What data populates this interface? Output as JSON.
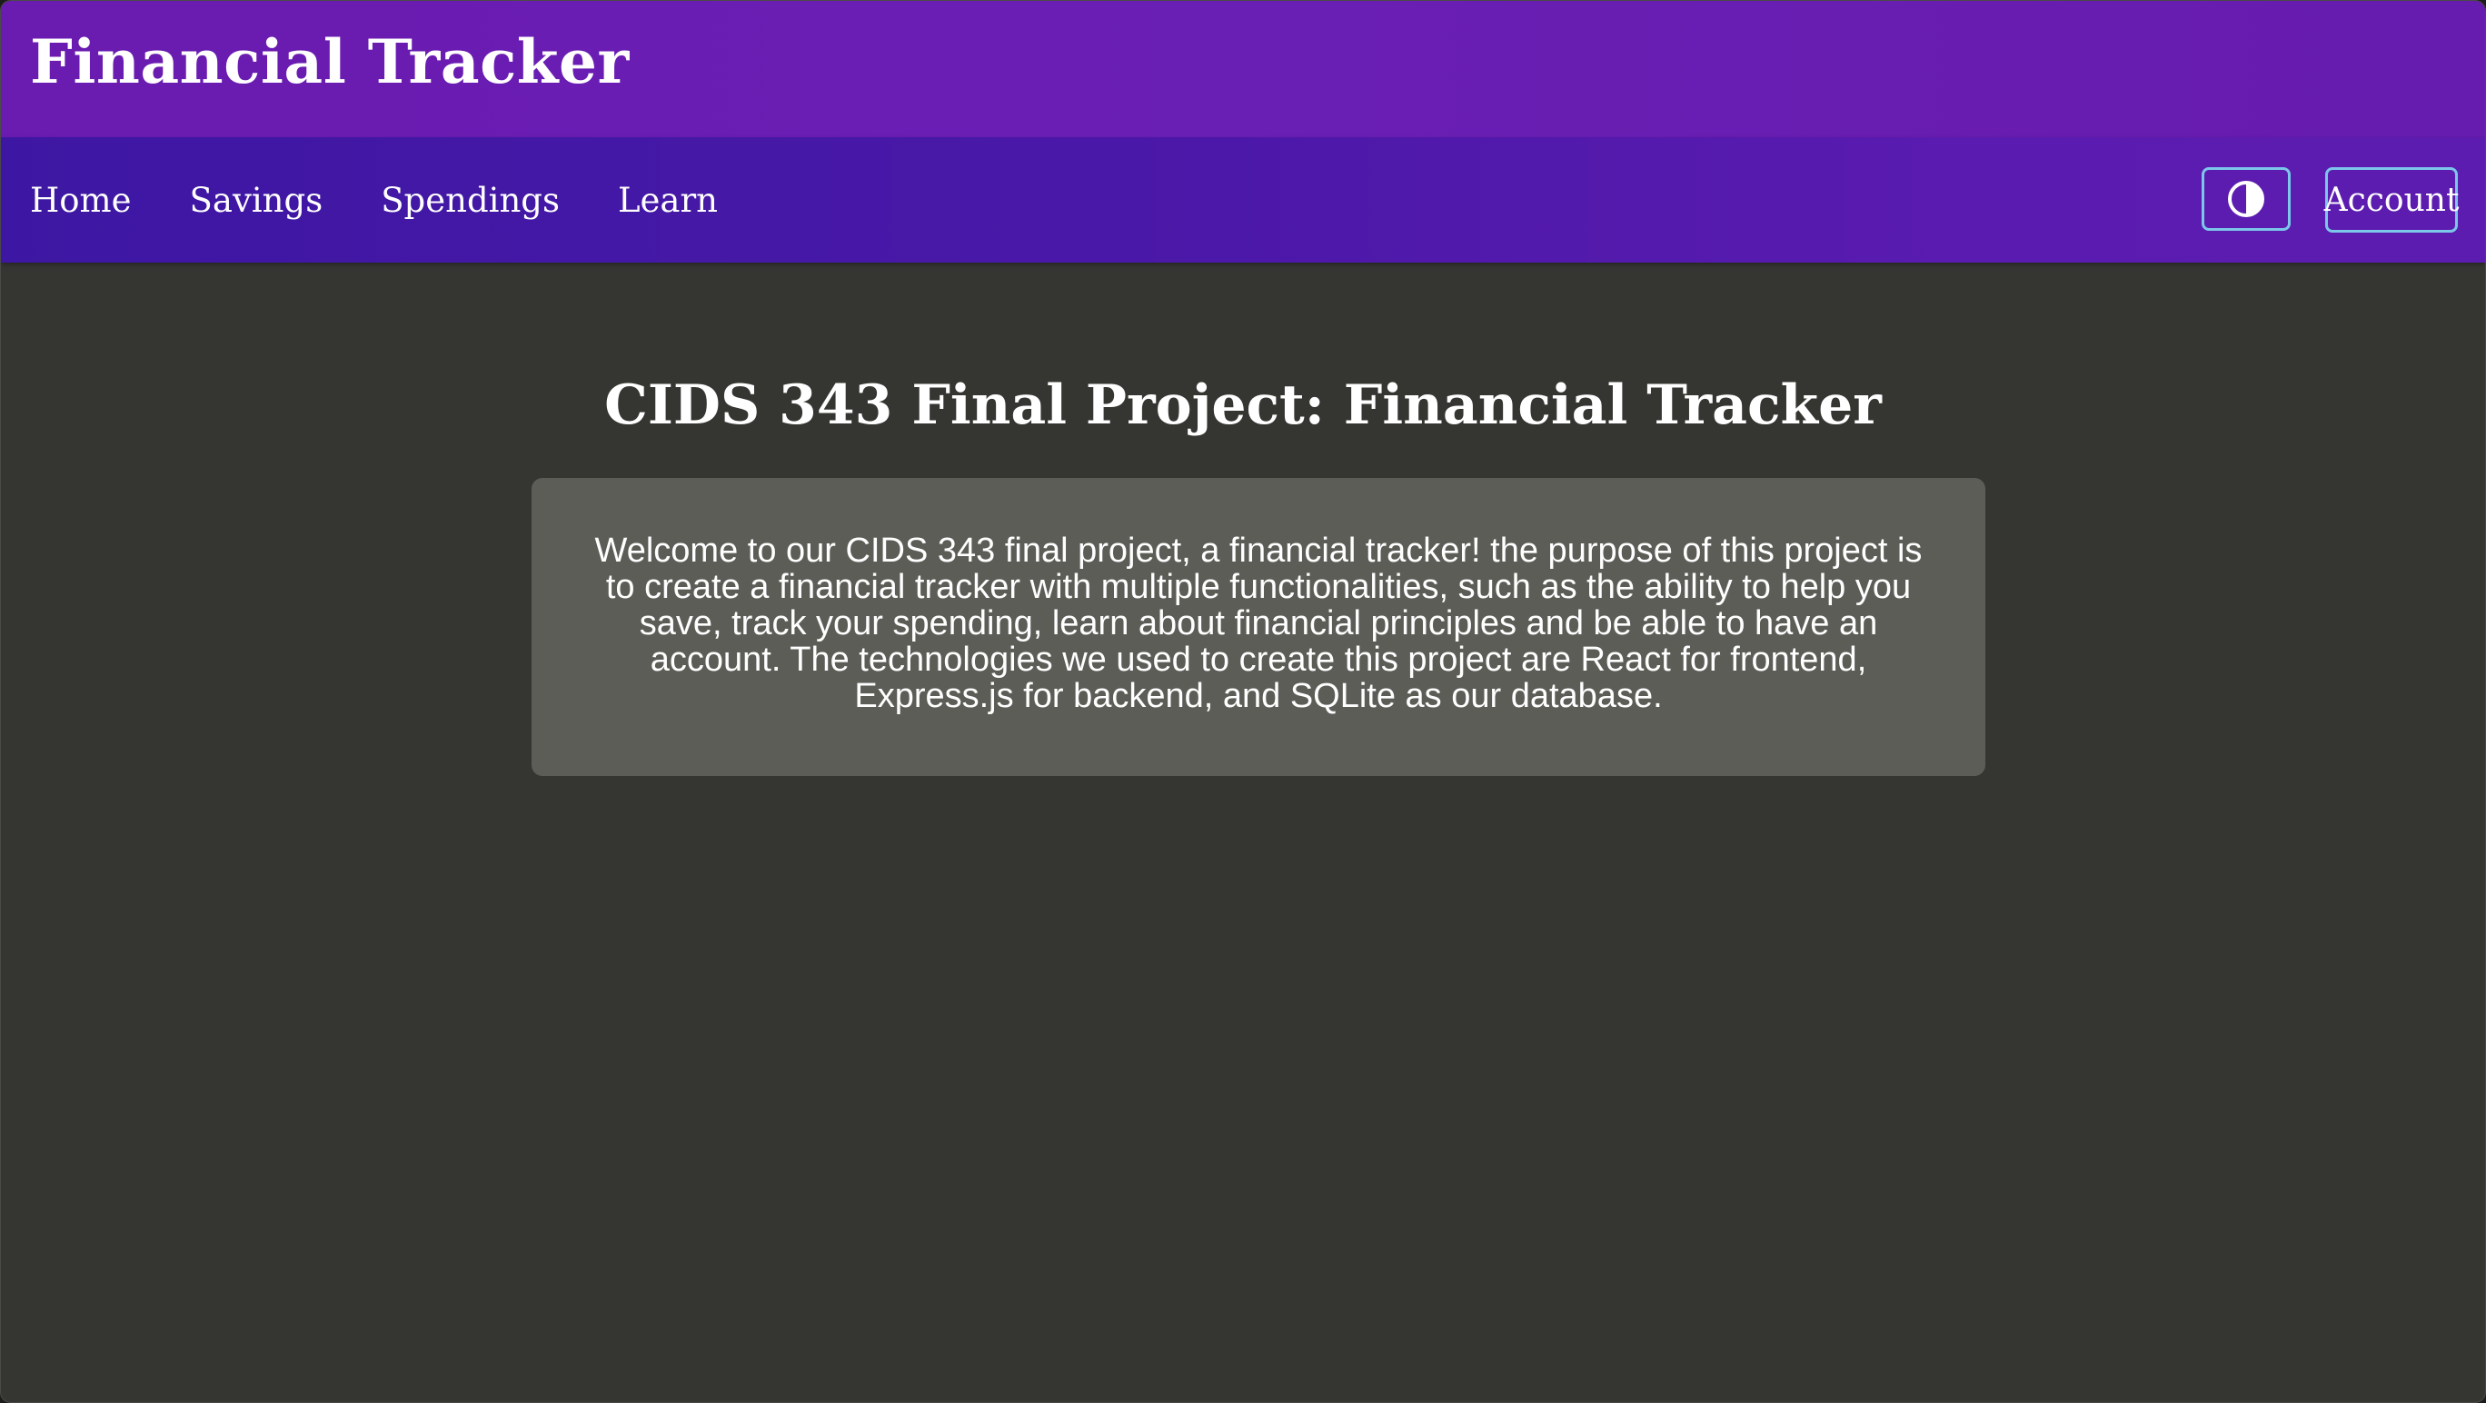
{
  "header": {
    "title": "Financial Tracker"
  },
  "nav": {
    "links": [
      {
        "label": "Home"
      },
      {
        "label": "Savings"
      },
      {
        "label": "Spendings"
      },
      {
        "label": "Learn"
      }
    ],
    "theme_toggle_icon": "contrast-icon",
    "account_label": "Account"
  },
  "main": {
    "heading": "CIDS 343 Final Project: Financial Tracker",
    "intro": "Welcome to our CIDS 343 final project, a financial tracker! the purpose of this project is to create a financial tracker with multiple functionalities, such as the ability to help you save, track your spending, learn about financial principles and be able to have an account. The technologies we used to create this project are React for frontend, Express.js for backend, and SQLite as our database."
  },
  "colors": {
    "header_bg": "#6a1bb0",
    "nav_bg": "#3d17a3",
    "button_border": "#7cc6ea",
    "page_bg": "#353532",
    "card_bg": "#5d5d58"
  }
}
